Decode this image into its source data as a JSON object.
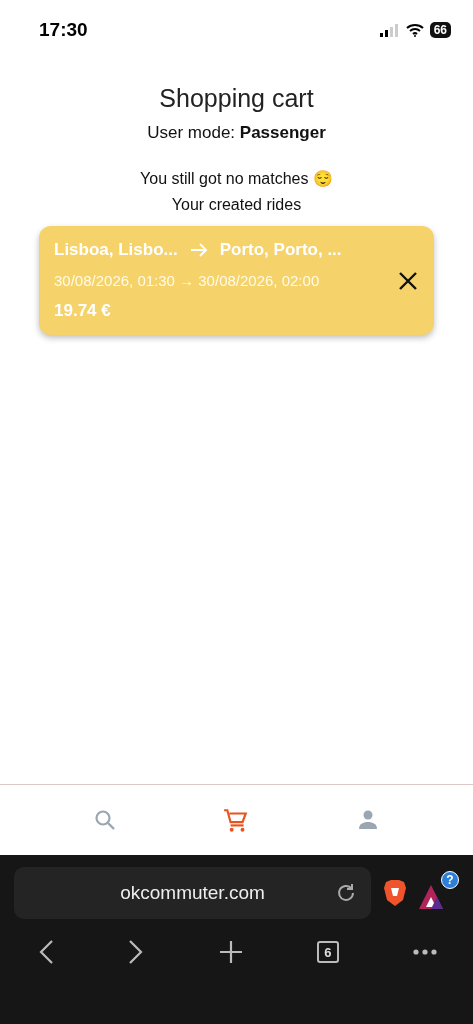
{
  "status_bar": {
    "time": "17:30",
    "battery": "66"
  },
  "title": "Shopping cart",
  "user_mode": "User mode: **Passenger**",
  "messages": [
    "You still got no matches 😌",
    "Your created rides"
  ],
  "rides": [
    {
      "from": "Lisboa, Lisbo...",
      "to": "Porto, Porto, ...",
      "times": "30/08/2026, 01:30 → 30/08/2026, 02:00",
      "price": "19.74 €"
    }
  ],
  "bottom_nav": [
    {
      "kind": "search",
      "selected": false
    },
    {
      "kind": "cart",
      "selected": true
    },
    {
      "kind": "profile",
      "selected": false
    }
  ],
  "browser": {
    "url": "okcommuter.com",
    "badge": "?",
    "tab_count": "6"
  }
}
